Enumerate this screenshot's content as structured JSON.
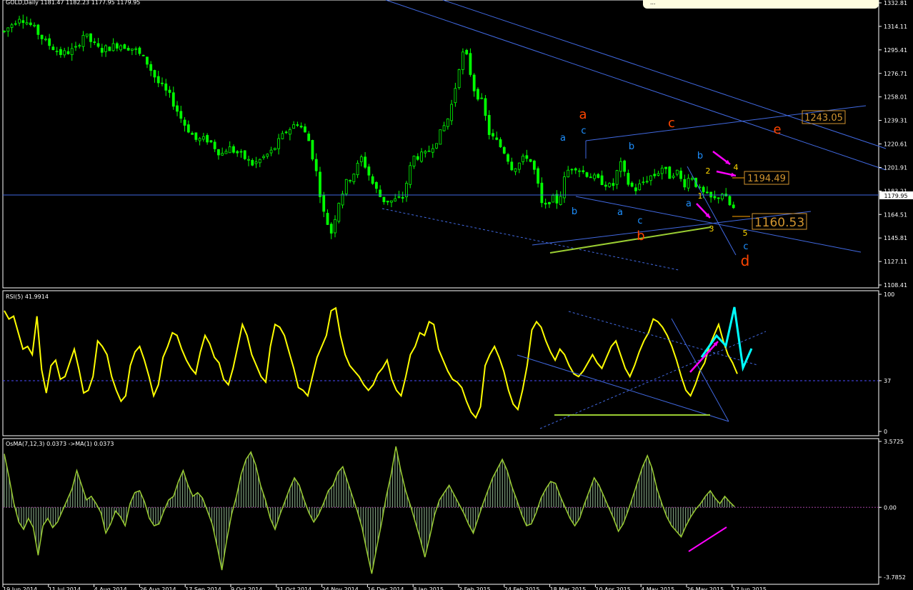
{
  "main_header": "GOLD,Daily  1181.47 1182.23 1177.95 1179.95",
  "rsi_header": "RSI(5) 41.9914",
  "osma_header": "OsMA(7,12,3) 0.0373  ->MA(1) 0.0373",
  "note_text": "...",
  "colors": {
    "background": "#000000",
    "candles": "#00ff00",
    "trendlines": "#4169e1",
    "rsi_line": "#ffff00",
    "osma_line": "#9acd32",
    "accent_magenta": "#ff00ff",
    "accent_cyan": "#00ffff",
    "wave_red": "#ff4500",
    "wave_blue": "#1e90ff",
    "price_box": "#d2952f"
  },
  "chart_data": [
    {
      "type": "candlestick",
      "title": "GOLD,Daily",
      "ylim": [
        1108.41,
        1332.81
      ],
      "yticks": [
        "1332.81",
        "1314.11",
        "1295.41",
        "1276.71",
        "1258.01",
        "1239.31",
        "1220.61",
        "1201.91",
        "1183.21",
        "1164.51",
        "1145.81",
        "1127.11",
        "1108.41"
      ],
      "current_price": "1179.95",
      "x_dates": [
        "19 Jun 2014",
        "11 Jul 2014",
        "4 Aug 2014",
        "26 Aug 2014",
        "17 Sep 2014",
        "9 Oct 2014",
        "31 Oct 2014",
        "24 Nov 2014",
        "16 Dec 2014",
        "8 Jan 2015",
        "2 Feb 2015",
        "24 Feb 2015",
        "18 Mar 2015",
        "10 Apr 2015",
        "4 May 2015",
        "26 May 2015",
        "17 Jun 2015"
      ],
      "close_path": [
        [
          0,
          1310
        ],
        [
          12,
          1322
        ],
        [
          22,
          1314
        ],
        [
          32,
          1302
        ],
        [
          45,
          1292
        ],
        [
          56,
          1296
        ],
        [
          62,
          1308
        ],
        [
          75,
          1295
        ],
        [
          90,
          1300
        ],
        [
          102,
          1296
        ],
        [
          112,
          1285
        ],
        [
          120,
          1270
        ],
        [
          130,
          1258
        ],
        [
          140,
          1238
        ],
        [
          150,
          1224
        ],
        [
          160,
          1224
        ],
        [
          170,
          1212
        ],
        [
          175,
          1218
        ],
        [
          185,
          1212
        ],
        [
          195,
          1204
        ],
        [
          210,
          1215
        ],
        [
          220,
          1230
        ],
        [
          230,
          1238
        ],
        [
          238,
          1225
        ],
        [
          244,
          1200
        ],
        [
          250,
          1166
        ],
        [
          256,
          1150
        ],
        [
          262,
          1175
        ],
        [
          268,
          1190
        ],
        [
          274,
          1198
        ],
        [
          280,
          1210
        ],
        [
          288,
          1190
        ],
        [
          296,
          1176
        ],
        [
          304,
          1175
        ],
        [
          312,
          1178
        ],
        [
          320,
          1210
        ],
        [
          330,
          1212
        ],
        [
          340,
          1226
        ],
        [
          348,
          1242
        ],
        [
          352,
          1259
        ],
        [
          358,
          1293
        ],
        [
          362,
          1290
        ],
        [
          368,
          1264
        ],
        [
          374,
          1254
        ],
        [
          380,
          1228
        ],
        [
          386,
          1222
        ],
        [
          392,
          1214
        ],
        [
          398,
          1201
        ],
        [
          404,
          1206
        ],
        [
          410,
          1212
        ],
        [
          416,
          1197
        ],
        [
          422,
          1167
        ],
        [
          428,
          1178
        ],
        [
          434,
          1174
        ],
        [
          440,
          1198
        ],
        [
          446,
          1204
        ],
        [
          452,
          1199
        ],
        [
          458,
          1196
        ],
        [
          464,
          1192
        ],
        [
          470,
          1190
        ],
        [
          476,
          1185
        ],
        [
          482,
          1206
        ],
        [
          488,
          1190
        ],
        [
          494,
          1184
        ],
        [
          500,
          1190
        ],
        [
          506,
          1195
        ],
        [
          510,
          1196
        ],
        [
          516,
          1203
        ],
        [
          520,
          1194
        ],
        [
          526,
          1200
        ],
        [
          532,
          1188
        ],
        [
          538,
          1196
        ],
        [
          544,
          1184
        ],
        [
          550,
          1179
        ],
        [
          556,
          1176
        ],
        [
          562,
          1182
        ],
        [
          568,
          1172
        ],
        [
          574,
          1166
        ]
      ],
      "waves": [
        {
          "label": "a",
          "color": "red"
        },
        {
          "label": "b",
          "color": "red"
        },
        {
          "label": "c",
          "color": "red"
        },
        {
          "label": "d",
          "color": "red"
        },
        {
          "label": "e",
          "color": "red"
        },
        {
          "label": "a",
          "color": "blue"
        },
        {
          "label": "c",
          "color": "blue"
        },
        {
          "label": "b",
          "color": "blue"
        },
        {
          "label": "a",
          "color": "blue"
        },
        {
          "label": "b",
          "color": "blue"
        },
        {
          "label": "c",
          "color": "blue"
        },
        {
          "label": "b",
          "color": "blue"
        },
        {
          "label": "a",
          "color": "blue"
        },
        {
          "label": "c",
          "color": "blue"
        },
        {
          "label": "1",
          "color": "yellow"
        },
        {
          "label": "2",
          "color": "yellow"
        },
        {
          "label": "3",
          "color": "yellow"
        },
        {
          "label": "4",
          "color": "yellow"
        },
        {
          "label": "5",
          "color": "yellow"
        }
      ],
      "price_levels": [
        "1243.05",
        "1194.49",
        "1160.53"
      ]
    },
    {
      "type": "line",
      "title": "RSI(5) 41.9914",
      "ylim": [
        0,
        100
      ],
      "yticks": [
        "100",
        "37",
        "0"
      ],
      "level": 37,
      "values": [
        88,
        82,
        84,
        72,
        60,
        62,
        56,
        84,
        45,
        28,
        48,
        52,
        38,
        40,
        50,
        60,
        45,
        28,
        30,
        40,
        66,
        62,
        56,
        40,
        30,
        22,
        26,
        48,
        58,
        62,
        52,
        40,
        26,
        34,
        54,
        62,
        72,
        70,
        60,
        52,
        46,
        42,
        58,
        70,
        64,
        54,
        50,
        38,
        34,
        46,
        62,
        78,
        70,
        56,
        48,
        40,
        36,
        62,
        78,
        76,
        70,
        58,
        46,
        32,
        30,
        26,
        40,
        54,
        62,
        70,
        88,
        90,
        70,
        56,
        48,
        44,
        40,
        34,
        30,
        34,
        42,
        46,
        52,
        38,
        30,
        26,
        40,
        56,
        62,
        72,
        70,
        80,
        78,
        60,
        52,
        44,
        38,
        36,
        32,
        22,
        14,
        10,
        18,
        48,
        56,
        62,
        54,
        44,
        30,
        20,
        16,
        30,
        48,
        74,
        80,
        76,
        66,
        58,
        52,
        60,
        56,
        48,
        42,
        40,
        44,
        50,
        56,
        50,
        46,
        54,
        62,
        66,
        56,
        46,
        40,
        48,
        58,
        66,
        72,
        82,
        80,
        76,
        70,
        62,
        52,
        40,
        30,
        26,
        34,
        44,
        50,
        62,
        70,
        78,
        66,
        56,
        50,
        42
      ],
      "series_line_color": "yellow"
    },
    {
      "type": "histogram",
      "title": "OsMA(7,12,3) 0.0373  ->MA(1) 0.0373",
      "ylim": [
        -3.7852,
        3.5725
      ],
      "yticks": [
        "3.5725",
        "0.00",
        "-3.7852"
      ],
      "values": [
        2.9,
        1.6,
        0.2,
        -0.8,
        -1.2,
        -0.6,
        -1.1,
        -2.6,
        -1.0,
        -0.6,
        -1.1,
        -0.8,
        -0.2,
        0.4,
        1.0,
        2.0,
        1.2,
        0.4,
        0.6,
        0.2,
        -0.3,
        -1.4,
        -0.9,
        -0.2,
        -0.5,
        -1.0,
        0.2,
        0.8,
        0.9,
        0.3,
        -0.6,
        -1.0,
        -0.9,
        -0.2,
        0.4,
        0.6,
        1.4,
        2.0,
        1.2,
        0.6,
        0.8,
        0.5,
        -0.2,
        -0.9,
        -2.1,
        -3.4,
        -1.8,
        -0.4,
        0.6,
        1.8,
        2.6,
        3.0,
        2.3,
        1.2,
        0.4,
        -0.6,
        -1.2,
        -0.4,
        0.3,
        1.0,
        1.6,
        1.2,
        0.4,
        -0.3,
        -0.8,
        -0.4,
        0.2,
        0.9,
        1.2,
        1.9,
        2.2,
        1.4,
        0.6,
        -0.2,
        -1.1,
        -2.4,
        -3.6,
        -2.2,
        -0.9,
        0.6,
        1.8,
        3.3,
        2.0,
        0.9,
        0.1,
        -0.8,
        -1.7,
        -2.7,
        -1.6,
        -0.4,
        0.4,
        0.8,
        1.2,
        0.7,
        0.2,
        -0.3,
        -0.9,
        -1.4,
        -0.6,
        0.2,
        0.9,
        1.6,
        2.1,
        2.6,
        2.0,
        1.1,
        0.4,
        -0.4,
        -1.0,
        -0.9,
        -0.3,
        0.5,
        1.0,
        1.4,
        1.3,
        0.6,
        0.0,
        -0.6,
        -1.0,
        -0.6,
        0.2,
        0.9,
        1.6,
        1.2,
        0.6,
        0.0,
        -0.6,
        -1.3,
        -0.9,
        -0.2,
        0.6,
        1.4,
        2.2,
        2.8,
        2.1,
        1.0,
        0.2,
        -0.5,
        -1.0,
        -1.3,
        -1.6,
        -1.0,
        -0.5,
        -0.1,
        0.2,
        0.6,
        0.9,
        0.5,
        0.2,
        0.6,
        0.3,
        0.04
      ],
      "zero_level": "0.00",
      "series_line_color": "yellowgreen"
    }
  ]
}
